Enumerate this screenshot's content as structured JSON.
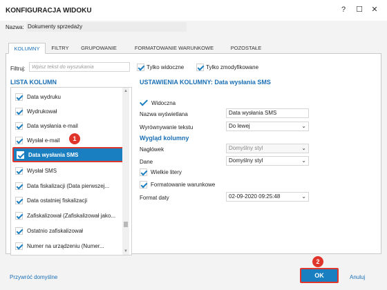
{
  "window": {
    "title": "KONFIGURACJA WIDOKU",
    "help_icon": "?",
    "maximize_icon": "☐",
    "close_icon": "✕"
  },
  "name": {
    "label": "Nazwa:",
    "value": "Dokumenty sprzedaży"
  },
  "tabs": [
    {
      "label": "KOLUMNY",
      "active": true
    },
    {
      "label": "FILTRY"
    },
    {
      "label": "GRUPOWANIE"
    },
    {
      "label": "FORMATOWANIE WARUNKOWE"
    },
    {
      "label": "POZOSTAŁE"
    }
  ],
  "filter": {
    "label": "Filtruj:",
    "placeholder": "Wpisz tekst do wyszukania",
    "only_visible": "Tylko widoczne",
    "only_modified": "Tylko zmodyfikowane"
  },
  "list": {
    "heading": "LISTA KOLUMN",
    "items": [
      {
        "label": "Data wydruku",
        "checked": true
      },
      {
        "label": "Wydrukował",
        "checked": true
      },
      {
        "label": "Data wysłania e-mail",
        "checked": true
      },
      {
        "label": "Wysłał e-mail",
        "checked": true
      },
      {
        "label": "Data wysłania SMS",
        "checked": true,
        "selected": true
      },
      {
        "label": "Wysłał SMS",
        "checked": true
      },
      {
        "label": "Data fiskalizacji (Data pierwszej...",
        "checked": true
      },
      {
        "label": "Data ostatniej fiskalizacji",
        "checked": true
      },
      {
        "label": "Zafiskalizował (Zafiskalizował jako...",
        "checked": true
      },
      {
        "label": "Ostatnio zafiskalizował",
        "checked": true
      },
      {
        "label": "Numer na urządzeniu (Numer...",
        "checked": true
      }
    ]
  },
  "settings": {
    "heading": "USTAWIENIA KOLUMNY: Data wysłania SMS",
    "visible_label": "Widoczna",
    "display_name_label": "Nazwa wyświetlana",
    "display_name_value": "Data wysłania SMS",
    "align_label": "Wyrównywanie tekstu",
    "align_value": "Do lewej",
    "look_heading": "Wygląd kolumny",
    "header_label": "Nagłówek",
    "header_value": "Domyślny styl",
    "data_label": "Dane",
    "data_value": "Domyślny styl",
    "uppercase_label": "Wielkie litery",
    "conditional_label": "Formatowanie warunkowe",
    "date_format_label": "Format daty",
    "date_format_value": "02-09-2020 09:25:48"
  },
  "footer": {
    "restore_default": "Przywróć domyślne",
    "ok": "OK",
    "cancel": "Anuluj"
  },
  "badges": {
    "one": "1",
    "two": "2"
  },
  "colors": {
    "accent": "#1a7fc1",
    "highlight": "#e0352b"
  }
}
